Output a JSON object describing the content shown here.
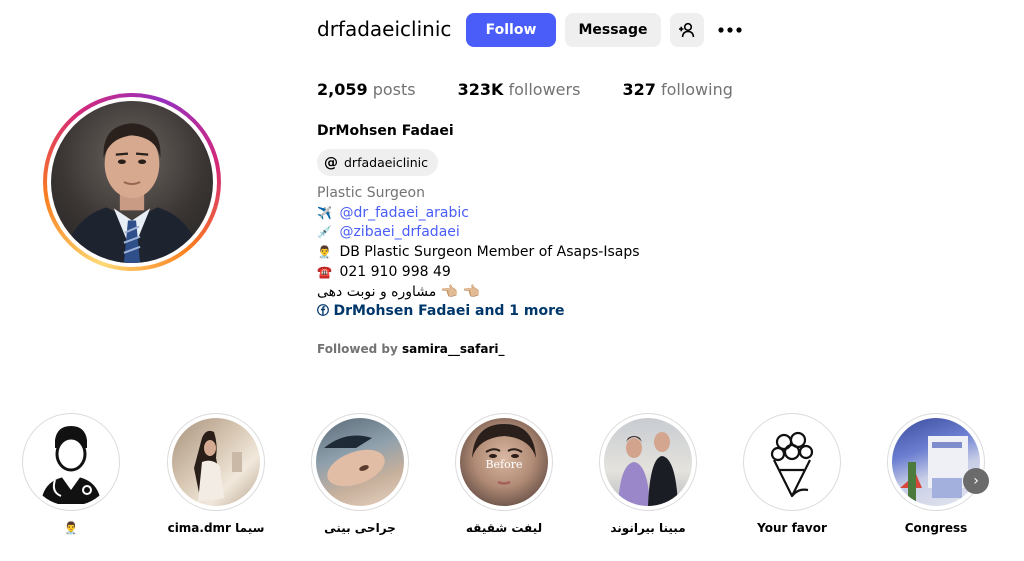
{
  "profile": {
    "username": "drfadaeiclinic",
    "full_name": "DrMohsen Fadaei",
    "threads_handle": "drfadaeiclinic"
  },
  "actions": {
    "follow_label": "Follow",
    "message_label": "Message"
  },
  "stats": {
    "posts_count": "2,059",
    "posts_label": "posts",
    "followers_count": "323K",
    "followers_label": "followers",
    "following_count": "327",
    "following_label": "following"
  },
  "bio": {
    "category": "Plastic Surgeon",
    "lines": [
      {
        "emoji": "✈️",
        "text": "@dr_fadaei_arabic"
      },
      {
        "emoji": "💉",
        "text": "@zibaei_drfadaei"
      },
      {
        "emoji": "👨‍⚕️",
        "text": "DB Plastic Surgeon Member of Asaps-Isaps"
      },
      {
        "emoji": "☎️",
        "text": "021 910 998 49"
      },
      {
        "emoji": "👈🏼 👈🏼",
        "text": "مشاوره و نوبت دهی"
      }
    ],
    "facebook_link": "DrMohsen Fadaei and 1 more"
  },
  "followed_by": {
    "prefix": "Followed by",
    "user": "samira__safari_"
  },
  "highlights": [
    {
      "label": "👨‍⚕️"
    },
    {
      "label": "cima.dmr سیما"
    },
    {
      "label": "جراحی بینی"
    },
    {
      "label": "لیفت شقیقه",
      "overlay": "Before"
    },
    {
      "label": "مبینا بیرانوند"
    },
    {
      "label": "Your favor"
    },
    {
      "label": "Congress"
    }
  ],
  "colors": {
    "follow_button": "#4a5df9",
    "link": "#4a5df9",
    "facebook_link": "#00376b"
  }
}
